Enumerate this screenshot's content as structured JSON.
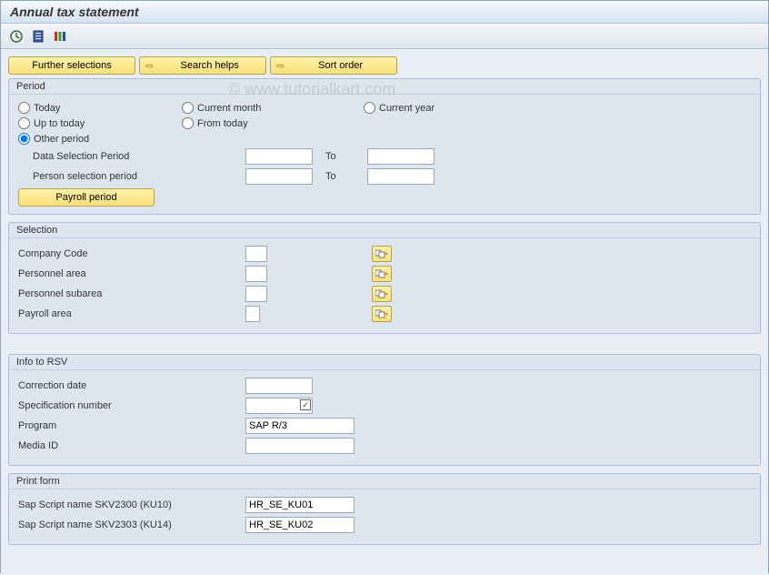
{
  "title": "Annual tax statement",
  "watermark": "© www.tutorialkart.com",
  "buttons": {
    "further": "Further selections",
    "search_helps": "Search helps",
    "sort_order": "Sort order",
    "payroll_period": "Payroll period"
  },
  "groups": {
    "period": {
      "title": "Period",
      "radios": {
        "today": "Today",
        "current_month": "Current month",
        "current_year": "Current year",
        "up_to_today": "Up to today",
        "from_today": "From today",
        "other_period": "Other period"
      },
      "data_selection": "Data Selection Period",
      "person_selection": "Person selection period",
      "to": "To",
      "data_from": "",
      "data_to": "",
      "person_from": "",
      "person_to": ""
    },
    "selection": {
      "title": "Selection",
      "company_code": "Company Code",
      "personnel_area": "Personnel area",
      "personnel_subarea": "Personnel subarea",
      "payroll_area": "Payroll area",
      "company_code_val": "",
      "personnel_area_val": "",
      "personnel_subarea_val": "",
      "payroll_area_val": ""
    },
    "rsv": {
      "title": "Info to RSV",
      "correction_date": "Correction date",
      "spec_number": "Specification number",
      "program": "Program",
      "media_id": "Media ID",
      "correction_date_val": "",
      "spec_number_val": "",
      "program_val": "SAP R/3",
      "media_id_val": ""
    },
    "print_form": {
      "title": "Print form",
      "skv2300": "Sap Script name SKV2300 (KU10)",
      "skv2303": "Sap Script name SKV2303 (KU14)",
      "skv2300_val": "HR_SE_KU01",
      "skv2303_val": "HR_SE_KU02"
    }
  }
}
